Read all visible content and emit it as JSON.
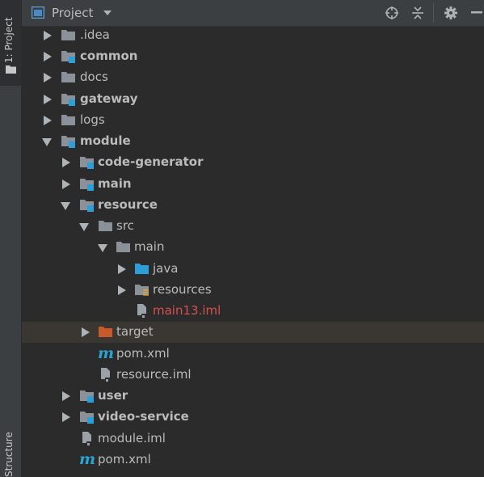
{
  "side_stripe": {
    "project_tab": "1: Project",
    "structure_tab": "Structure"
  },
  "header": {
    "title": "Project"
  },
  "tree": {
    "items": [
      {
        "label": ".idea",
        "bold": false,
        "icon": "folder-icon",
        "arrow": "collapsed"
      },
      {
        "label": "common",
        "bold": true,
        "icon": "module-folder-icon",
        "arrow": "collapsed"
      },
      {
        "label": "docs",
        "bold": false,
        "icon": "folder-icon",
        "arrow": "collapsed"
      },
      {
        "label": "gateway",
        "bold": true,
        "icon": "module-folder-icon",
        "arrow": "collapsed"
      },
      {
        "label": "logs",
        "bold": false,
        "icon": "folder-icon",
        "arrow": "collapsed"
      },
      {
        "label": "module",
        "bold": true,
        "icon": "module-folder-icon",
        "arrow": "expanded"
      },
      {
        "label": "code-generator",
        "bold": true,
        "icon": "module-folder-icon",
        "arrow": "collapsed"
      },
      {
        "label": "main",
        "bold": true,
        "icon": "module-folder-icon",
        "arrow": "collapsed"
      },
      {
        "label": "resource",
        "bold": true,
        "icon": "module-folder-icon",
        "arrow": "expanded"
      },
      {
        "label": "src",
        "bold": false,
        "icon": "folder-icon",
        "arrow": "expanded"
      },
      {
        "label": "main",
        "bold": false,
        "icon": "folder-icon",
        "arrow": "expanded"
      },
      {
        "label": "java",
        "bold": false,
        "icon": "source-folder-icon",
        "arrow": "collapsed"
      },
      {
        "label": "resources",
        "bold": false,
        "icon": "resources-folder-icon",
        "arrow": "collapsed"
      },
      {
        "label": "main13.iml",
        "bold": false,
        "icon": "iml-file-icon",
        "arrow": "none",
        "color": "#d75050"
      },
      {
        "label": "target",
        "bold": false,
        "icon": "excluded-folder-icon",
        "arrow": "collapsed",
        "selected": true
      },
      {
        "label": "pom.xml",
        "bold": false,
        "icon": "maven-icon",
        "arrow": "none"
      },
      {
        "label": "resource.iml",
        "bold": false,
        "icon": "iml-file-icon",
        "arrow": "none"
      },
      {
        "label": "user",
        "bold": true,
        "icon": "module-folder-icon",
        "arrow": "collapsed"
      },
      {
        "label": "video-service",
        "bold": true,
        "icon": "module-folder-icon",
        "arrow": "collapsed"
      },
      {
        "label": "module.iml",
        "bold": false,
        "icon": "iml-file-icon",
        "arrow": "none"
      },
      {
        "label": "pom.xml",
        "bold": false,
        "icon": "maven-icon",
        "arrow": "none"
      }
    ]
  },
  "colors": {
    "background": "#2b2b2b",
    "panel": "#3c3f41",
    "folder": "#8a9199",
    "module_badge": "#2e9ed8",
    "excluded_folder": "#c7592b",
    "iml_error": "#d75050",
    "maven": "#29a5d4",
    "selection": "#3a3632"
  }
}
